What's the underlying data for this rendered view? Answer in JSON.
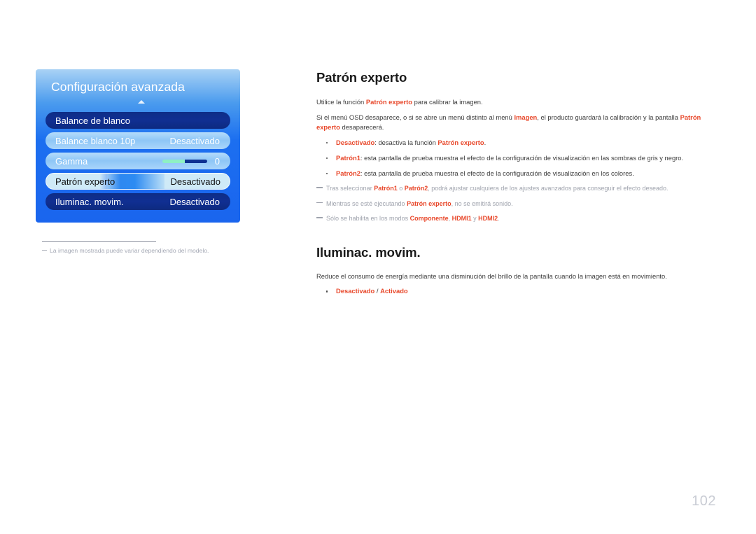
{
  "osd": {
    "title": "Configuración avanzada",
    "up_arrow_icon": "caret-up-icon",
    "rows": [
      {
        "label": "Balance de blanco",
        "value": "",
        "style": "dark"
      },
      {
        "label": "Balance blanco 10p",
        "value": "Desactivado",
        "style": "light"
      },
      {
        "label": "Gamma",
        "value": "0",
        "style": "light",
        "slider": {
          "percent": 50
        }
      },
      {
        "label": "Patrón experto",
        "value": "Desactivado",
        "style": "selected"
      },
      {
        "label": "Iluminac. movim.",
        "value": "Desactivado",
        "style": "dark"
      }
    ]
  },
  "figure_note": "La imagen mostrada puede variar dependiendo del modelo.",
  "sections": [
    {
      "title": "Patrón experto",
      "paragraphs": [
        [
          {
            "t": "Utilice la función ",
            "em": false
          },
          {
            "t": "Patrón experto",
            "em": true
          },
          {
            "t": " para calibrar la imagen.",
            "em": false
          }
        ],
        [
          {
            "t": "Si el menú OSD desaparece, o si se abre un menú distinto al menú ",
            "em": false
          },
          {
            "t": "Imagen",
            "em": true
          },
          {
            "t": ", el producto guardará la calibración y la pantalla ",
            "em": false
          },
          {
            "t": "Patrón experto",
            "em": true
          },
          {
            "t": " desaparecerá.",
            "em": false
          }
        ]
      ],
      "bullets": [
        [
          {
            "t": "Desactivado",
            "em": true
          },
          {
            "t": ": desactiva la función ",
            "em": false
          },
          {
            "t": "Patrón experto",
            "em": true
          },
          {
            "t": ".",
            "em": false
          }
        ],
        [
          {
            "t": "Patrón1",
            "em": true
          },
          {
            "t": ": esta pantalla de prueba muestra el efecto de la configuración de visualización en las sombras de gris y negro.",
            "em": false
          }
        ],
        [
          {
            "t": "Patrón2",
            "em": true
          },
          {
            "t": ": esta pantalla de prueba muestra el efecto de la configuración de visualización en los colores.",
            "em": false
          }
        ]
      ],
      "notes": [
        [
          {
            "t": "Tras seleccionar ",
            "em": false
          },
          {
            "t": "Patrón1",
            "em": true
          },
          {
            "t": " o ",
            "em": false
          },
          {
            "t": "Patrón2",
            "em": true
          },
          {
            "t": ", podrá ajustar cualquiera de los ajustes avanzados para conseguir el efecto deseado.",
            "em": false
          }
        ],
        [
          {
            "t": "Mientras se esté ejecutando ",
            "em": false
          },
          {
            "t": "Patrón experto",
            "em": true
          },
          {
            "t": ", no se emitirá sonido.",
            "em": false
          }
        ],
        [
          {
            "t": "Sólo se habilita en los modos ",
            "em": false
          },
          {
            "t": "Componente",
            "em": true
          },
          {
            "t": ", ",
            "em": false
          },
          {
            "t": "HDMI1",
            "em": true
          },
          {
            "t": " y ",
            "em": false
          },
          {
            "t": "HDMI2",
            "em": true
          },
          {
            "t": ".",
            "em": false
          }
        ]
      ]
    },
    {
      "title": "Iluminac. movim.",
      "paragraphs": [
        [
          {
            "t": "Reduce el consumo de energía mediante una disminución del brillo de la pantalla cuando la imagen está en movimiento.",
            "em": false
          }
        ]
      ],
      "bullets": [
        [
          {
            "t": "Desactivado",
            "em": true
          },
          {
            "t": " / ",
            "em": false
          },
          {
            "t": "Activado",
            "em": true
          }
        ]
      ],
      "notes": []
    }
  ],
  "page_number": "102",
  "colors": {
    "accent_red": "#e8482b",
    "osd_blue": "#1c6ff0",
    "osd_dark_row": "#102f92",
    "page_number_gray": "#c9ccd4"
  }
}
